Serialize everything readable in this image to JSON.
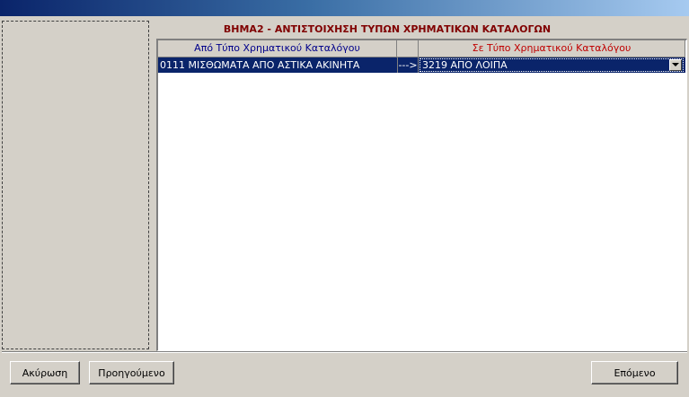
{
  "step_title": "ΒΗΜΑ2 - ΑΝΤΙΣΤΟΙΧΗΣΗ ΤΥΠΩΝ ΧΡΗΜΑΤΙΚΩΝ ΚΑΤΑΛΟΓΩΝ",
  "grid": {
    "columns": {
      "from": "Από  Τύπο Χρηματικού  Καταλόγου",
      "arrow": "",
      "to": "Σε  Τύπο Χρηματικού  Καταλόγου"
    },
    "rows": [
      {
        "from": "0111 ΜΙΣΘΩΜΑΤΑ ΑΠΟ ΑΣΤΙΚΑ ΑΚΙΝΗΤΑ",
        "arrow": "--->",
        "to": "3219 ΑΠΟ ΛΟΙΠΑ"
      }
    ]
  },
  "buttons": {
    "cancel": "Ακύρωση",
    "previous": "Προηγούμενο",
    "next": "Επόμενο"
  },
  "colors": {
    "title_text": "#800000",
    "from_header_text": "#00008b",
    "to_header_text": "#c00000",
    "selection": "#0a246a"
  }
}
